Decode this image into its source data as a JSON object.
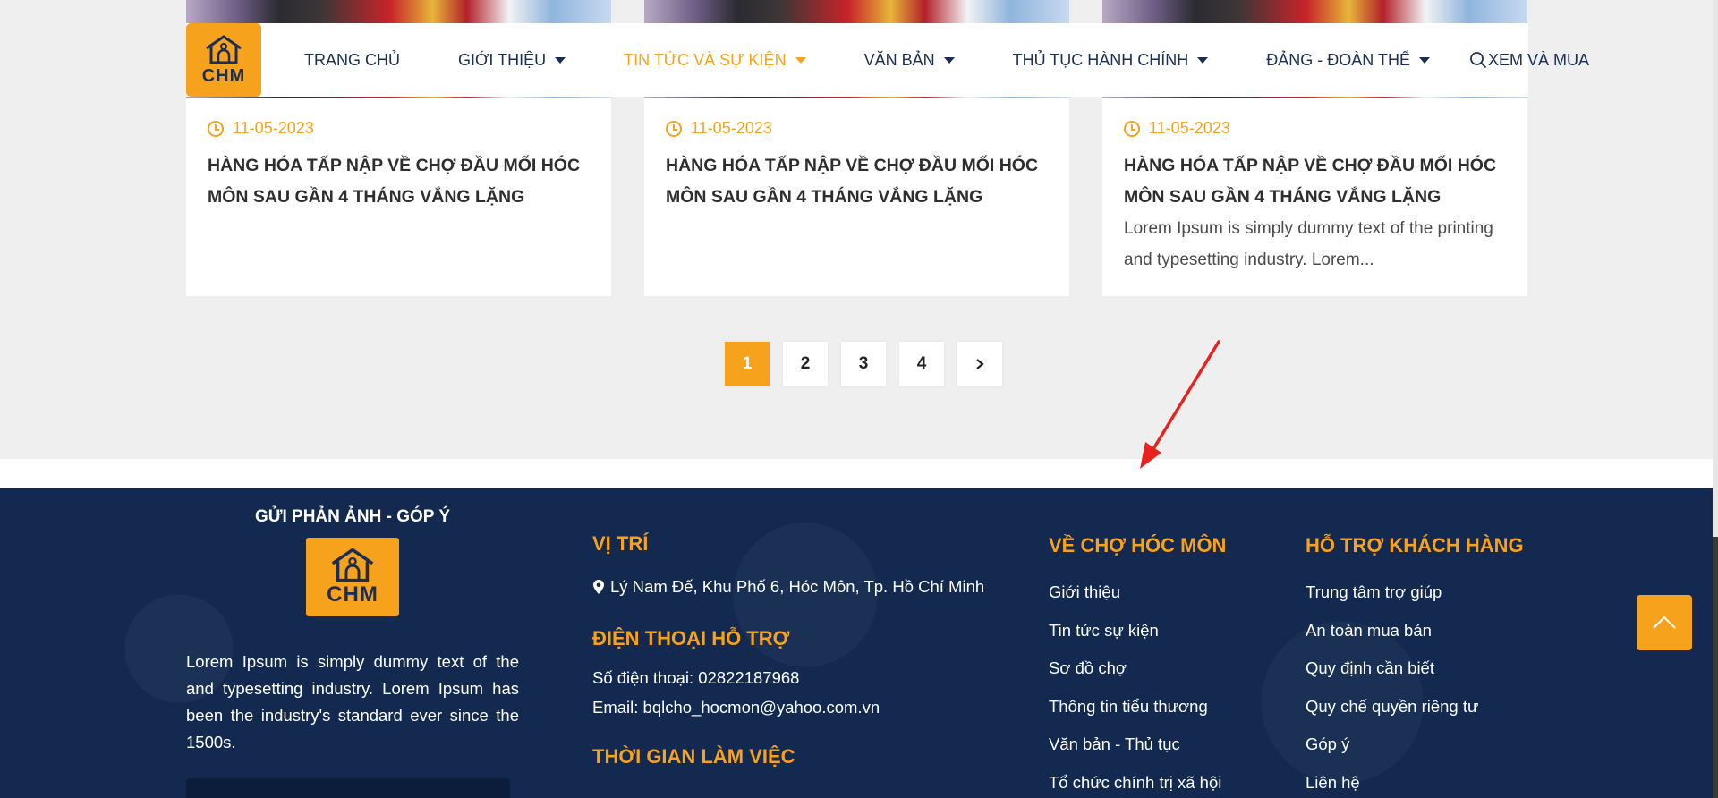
{
  "nav": {
    "logo_text": "CHM",
    "items": [
      {
        "label": "TRANG CHỦ",
        "dropdown": false,
        "active": false
      },
      {
        "label": "GIỚI THIỆU",
        "dropdown": true,
        "active": false
      },
      {
        "label": "TIN TỨC VÀ SỰ KIỆN",
        "dropdown": true,
        "active": true
      },
      {
        "label": "VĂN BẢN",
        "dropdown": true,
        "active": false
      },
      {
        "label": "THỦ TỤC HÀNH CHÍNH",
        "dropdown": true,
        "active": false
      },
      {
        "label": "ĐẢNG - ĐOÀN THỂ",
        "dropdown": true,
        "active": false
      },
      {
        "label": "XEM VÀ MUA",
        "dropdown": false,
        "active": false
      }
    ],
    "search_icon": "search-icon"
  },
  "cards": [
    {
      "date": "11-05-2023",
      "title": "HÀNG HÓA TẤP NẬP VỀ CHỢ ĐẦU MỐI HÓC MÔN SAU GẦN 4 THÁNG VẮNG LẶNG",
      "desc": ""
    },
    {
      "date": "11-05-2023",
      "title": "HÀNG HÓA TẤP NẬP VỀ CHỢ ĐẦU MỐI HÓC MÔN SAU GẦN 4 THÁNG VẮNG LẶNG",
      "desc": ""
    },
    {
      "date": "11-05-2023",
      "title": "HÀNG HÓA TẤP NẬP VỀ CHỢ ĐẦU MỐI HÓC MÔN SAU GẦN 4 THÁNG VẮNG LẶNG",
      "desc": "Lorem Ipsum is simply dummy text of the printing and typesetting industry. Lorem..."
    }
  ],
  "pagination": {
    "pages": [
      "1",
      "2",
      "3",
      "4"
    ],
    "current": "1",
    "next_label": "›"
  },
  "footer": {
    "feedback_title": "GỬI PHẢN ẢNH - GÓP Ý",
    "logo_text": "CHM",
    "about_text": "Lorem Ipsum is simply dummy text of the and typesetting industry. Lorem Ipsum has been the industry's standard ever since the 1500s.",
    "location_heading": "VỊ TRÍ",
    "address": "Lý Nam Đế, Khu Phố 6, Hóc Môn, Tp. Hồ Chí Minh",
    "phone_heading": "ĐIỆN THOẠI HỖ TRỢ",
    "phone": "Số điện thoại: 02822187968",
    "email": "Email: bqlcho_hocmon@yahoo.com.vn",
    "time_heading": "THỜI GIAN LÀM VIỆC",
    "market_heading": "VỀ CHỢ HÓC MÔN",
    "market_links": [
      "Giới thiệu",
      "Tin tức sự kiện",
      "Sơ đồ chợ",
      "Thông tin tiểu thương",
      "Văn bản - Thủ tục",
      "Tổ chức chính trị xã hội"
    ],
    "support_heading": "HỖ TRỢ KHÁCH HÀNG",
    "support_links": [
      "Trung tâm trợ giúp",
      "An toàn mua bán",
      "Quy định cần biết",
      "Quy chế quyền riêng tư",
      "Góp ý",
      "Liên hệ"
    ]
  },
  "colors": {
    "accent": "#f7a21c",
    "navy": "#13294f",
    "annotation_arrow": "#e8231f"
  }
}
